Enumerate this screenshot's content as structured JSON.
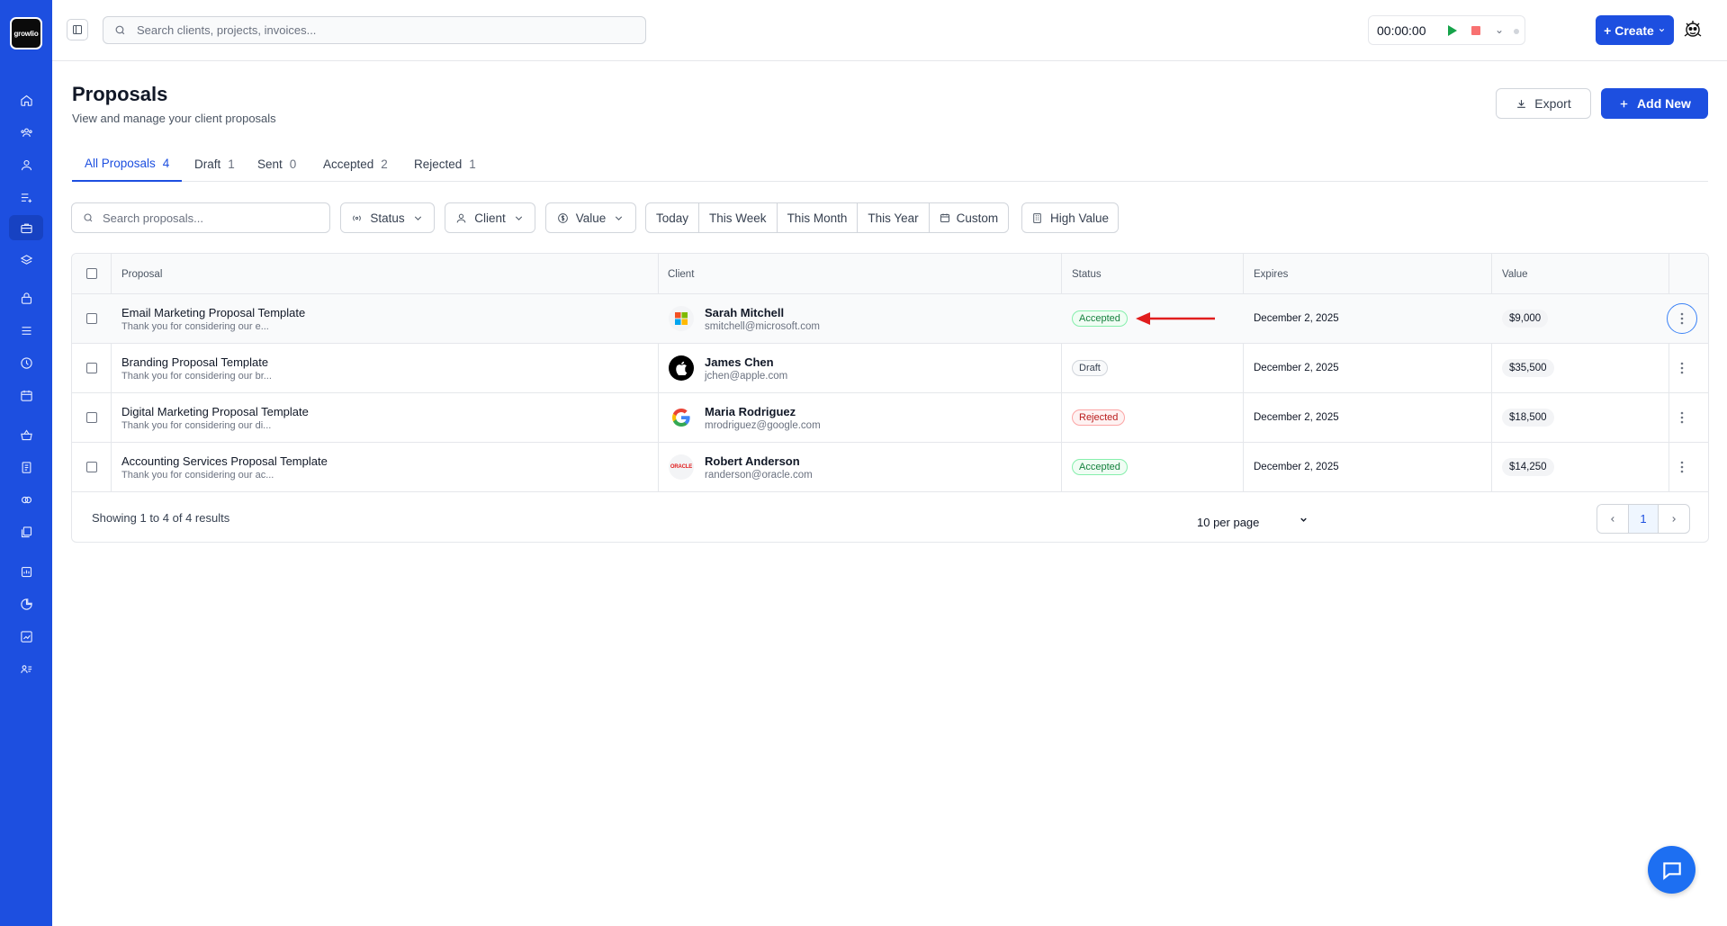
{
  "app": {
    "logo_text": "growlio"
  },
  "topbar": {
    "search_placeholder": "Search clients, projects, invoices...",
    "timer": "00:00:00",
    "create_label": "+ Create"
  },
  "page": {
    "title": "Proposals",
    "subtitle": "View and manage your client proposals",
    "export_label": "Export",
    "add_new_label": "Add New"
  },
  "tabs": [
    {
      "label": "All Proposals",
      "count": "4"
    },
    {
      "label": "Draft",
      "count": "1"
    },
    {
      "label": "Sent",
      "count": "0"
    },
    {
      "label": "Accepted",
      "count": "2"
    },
    {
      "label": "Rejected",
      "count": "1"
    }
  ],
  "filters": {
    "search_placeholder": "Search proposals...",
    "status": "Status",
    "client": "Client",
    "value": "Value",
    "periods": [
      "Today",
      "This Week",
      "This Month",
      "This Year",
      "Custom"
    ],
    "high_value": "High Value"
  },
  "table": {
    "headers": {
      "proposal": "Proposal",
      "client": "Client",
      "status": "Status",
      "expires": "Expires",
      "value": "Value"
    },
    "rows": [
      {
        "title": "Email Marketing Proposal Template",
        "desc": "Thank you for considering our e...",
        "client_name": "Sarah Mitchell",
        "client_email": "smitchell@microsoft.com",
        "client_logo": "microsoft-logo",
        "status": "Accepted",
        "expires": "December 2, 2025",
        "value": "$9,000"
      },
      {
        "title": "Branding Proposal Template",
        "desc": "Thank you for considering our br...",
        "client_name": "James Chen",
        "client_email": "jchen@apple.com",
        "client_logo": "apple-logo",
        "status": "Draft",
        "expires": "December 2, 2025",
        "value": "$35,500"
      },
      {
        "title": "Digital Marketing Proposal Template",
        "desc": "Thank you for considering our di...",
        "client_name": "Maria Rodriguez",
        "client_email": "mrodriguez@google.com",
        "client_logo": "google-logo",
        "status": "Rejected",
        "expires": "December 2, 2025",
        "value": "$18,500"
      },
      {
        "title": "Accounting Services Proposal Template",
        "desc": "Thank you for considering our ac...",
        "client_name": "Robert Anderson",
        "client_email": "randerson@oracle.com",
        "client_logo": "oracle-logo",
        "status": "Accepted",
        "expires": "December 2, 2025",
        "value": "$14,250"
      }
    ],
    "footer_text": "Showing 1 to 4 of 4 results",
    "per_page": "10 per page",
    "current_page": "1",
    "oracle_text": "ORACLE"
  },
  "colors": {
    "primary": "#1d4fe0",
    "accepted": "#15803d",
    "rejected": "#b91c1c",
    "annotation_arrow": "#e11d1d"
  }
}
